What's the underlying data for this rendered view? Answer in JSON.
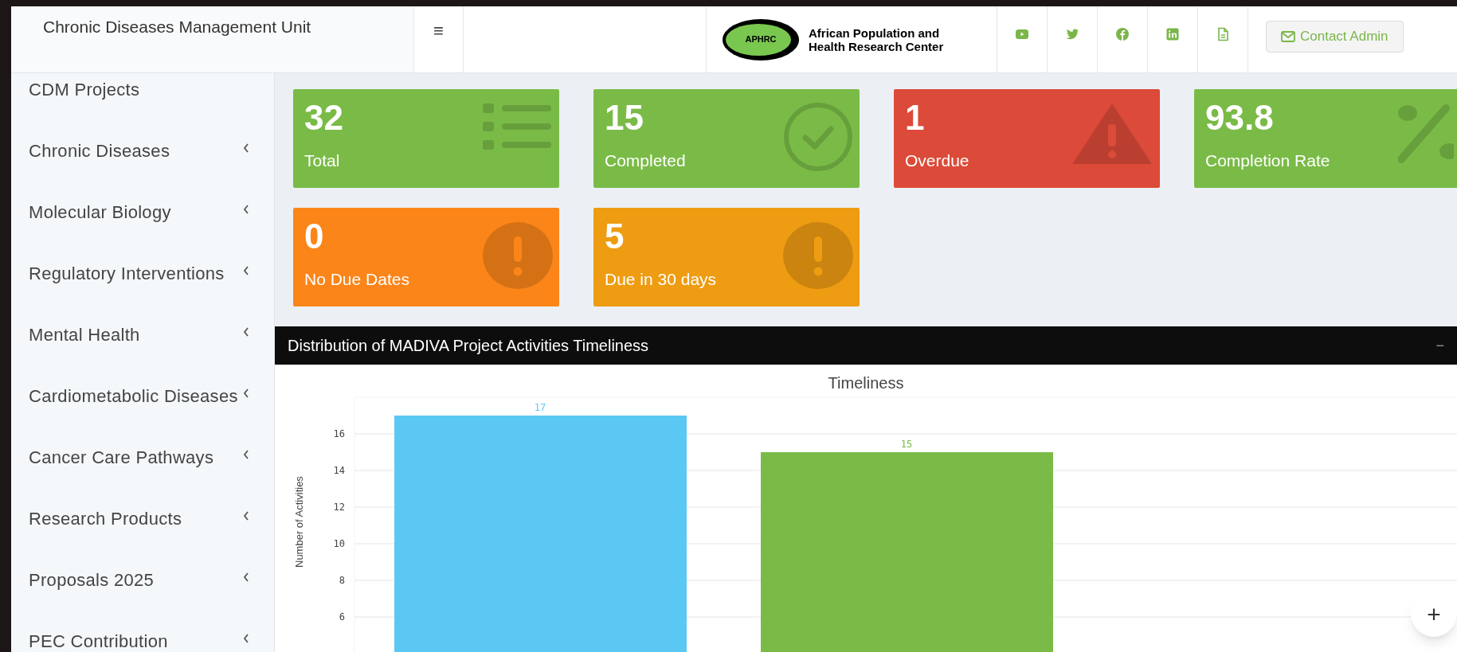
{
  "header": {
    "title": "Chronic Diseases Management Unit",
    "menu_icon": "≡",
    "org_name_line1": "African Population and",
    "org_name_line2": "Health Research Center",
    "logo_text": "APHRC",
    "contact_button": "Contact Admin"
  },
  "sidebar": {
    "items": [
      {
        "label": "CDM Projects",
        "expandable": false
      },
      {
        "label": "Chronic Diseases",
        "expandable": true
      },
      {
        "label": "Molecular Biology",
        "expandable": true
      },
      {
        "label": "Regulatory Interventions",
        "expandable": true
      },
      {
        "label": "Mental Health",
        "expandable": true
      },
      {
        "label": "Cardiometabolic Diseases",
        "expandable": true
      },
      {
        "label": "Cancer Care Pathways",
        "expandable": true
      },
      {
        "label": "Research Products",
        "expandable": true
      },
      {
        "label": "Proposals 2025",
        "expandable": true
      },
      {
        "label": "PEC Contribution",
        "expandable": true
      }
    ]
  },
  "stats": [
    {
      "value": "32",
      "label": "Total",
      "color": "#7abb47",
      "kind": "list"
    },
    {
      "value": "15",
      "label": "Completed",
      "color": "#7abb47",
      "kind": "check"
    },
    {
      "value": "1",
      "label": "Overdue",
      "color": "#dc4a39",
      "kind": "warning"
    },
    {
      "value": "93.8",
      "label": "Completion Rate",
      "color": "#7abb47",
      "kind": "percent"
    },
    {
      "value": "0",
      "label": "No Due Dates",
      "color": "#fb8519",
      "kind": "alert"
    },
    {
      "value": "5",
      "label": "Due in 30 days",
      "color": "#ee9c12",
      "kind": "alert"
    }
  ],
  "chart_panel": {
    "title": "Distribution of MADIVA Project Activities Timeliness",
    "collapse_icon": "−",
    "chart_data": {
      "type": "bar",
      "title": "Timeliness",
      "ylabel": "Number of Activities",
      "series": [
        {
          "values": [
            17,
            15
          ]
        }
      ],
      "colors": [
        "#5bc8f4",
        "#7abb47"
      ],
      "ylim": [
        4.087,
        18
      ],
      "yticks": [
        6,
        8,
        10,
        12,
        14,
        16
      ],
      "grid": true,
      "value_labels": [
        "17",
        "15"
      ]
    }
  },
  "fab": {
    "label": "+"
  }
}
